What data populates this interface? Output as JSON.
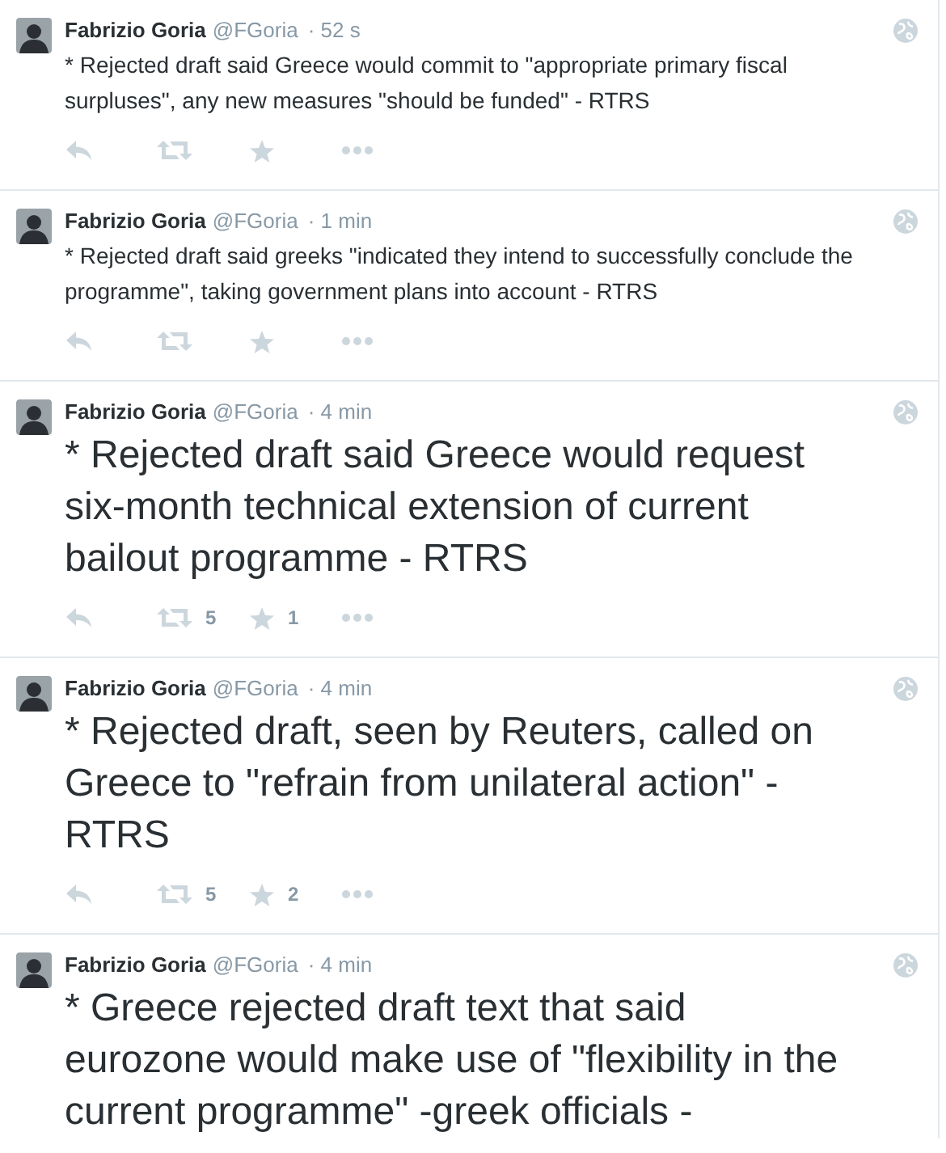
{
  "tweets": [
    {
      "name": "Fabrizio Goria",
      "handle": "@FGoria",
      "time": "· 52 s",
      "kind": "normal",
      "text": "* Rejected draft said Greece would commit to \"appropriate primary fiscal surpluses\", any new measures \"should be funded\" - RTRS",
      "actions_visible": true
    },
    {
      "name": "Fabrizio Goria",
      "handle": "@FGoria",
      "time": "· 1 min",
      "kind": "normal",
      "text": "* Rejected draft said greeks \"indicated they intend to successfully conclude the programme\", taking government plans into account - RTRS",
      "actions_visible": true
    },
    {
      "name": "Fabrizio Goria",
      "handle": "@FGoria",
      "time": "· 4 min",
      "kind": "large",
      "text": "* Rejected draft said Greece would request six-month technical extension of current bailout programme - RTRS",
      "retweets": "5",
      "favorites": "1",
      "actions_visible": true
    },
    {
      "name": "Fabrizio Goria",
      "handle": "@FGoria",
      "time": "· 4 min",
      "kind": "large",
      "text": "* Rejected draft, seen by Reuters, called on Greece to \"refrain from unilateral action\" - RTRS",
      "retweets": "5",
      "favorites": "2",
      "actions_visible": true
    },
    {
      "name": "Fabrizio Goria",
      "handle": "@FGoria",
      "time": "· 4 min",
      "kind": "large",
      "text": "* Greece rejected draft text that said eurozone would make use of \"flexibility in the current programme\" -greek officials -"
    }
  ]
}
